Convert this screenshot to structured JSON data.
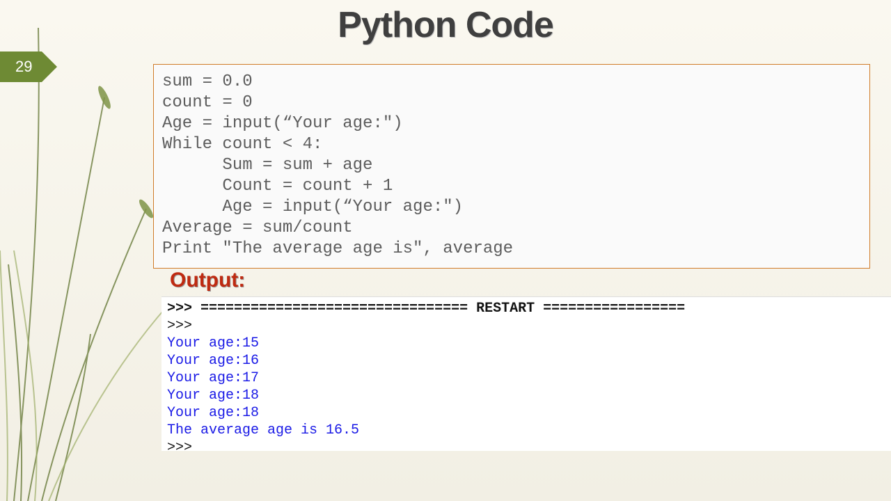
{
  "slide": {
    "number": "29",
    "title": "Python Code"
  },
  "code": {
    "lines": [
      "sum = 0.0",
      "count = 0",
      "Age = input(“Your age:\")",
      "While count < 4:",
      "      Sum = sum + age",
      "      Count = count + 1",
      "      Age = input(“Your age:\")",
      "Average = sum/count",
      "Print \"The average age is\", average"
    ]
  },
  "output": {
    "label": "Output:",
    "restart_line": ">>> ================================ RESTART =================",
    "empty_prompt": ">>> ",
    "interactions": [
      {
        "prompt": "Your age:",
        "value": "15"
      },
      {
        "prompt": "Your age:",
        "value": "16"
      },
      {
        "prompt": "Your age:",
        "value": "17"
      },
      {
        "prompt": "Your age:",
        "value": "18"
      },
      {
        "prompt": "Your age:",
        "value": "18"
      }
    ],
    "result": "The average age is 16.5",
    "final_prompt": ">>> "
  }
}
